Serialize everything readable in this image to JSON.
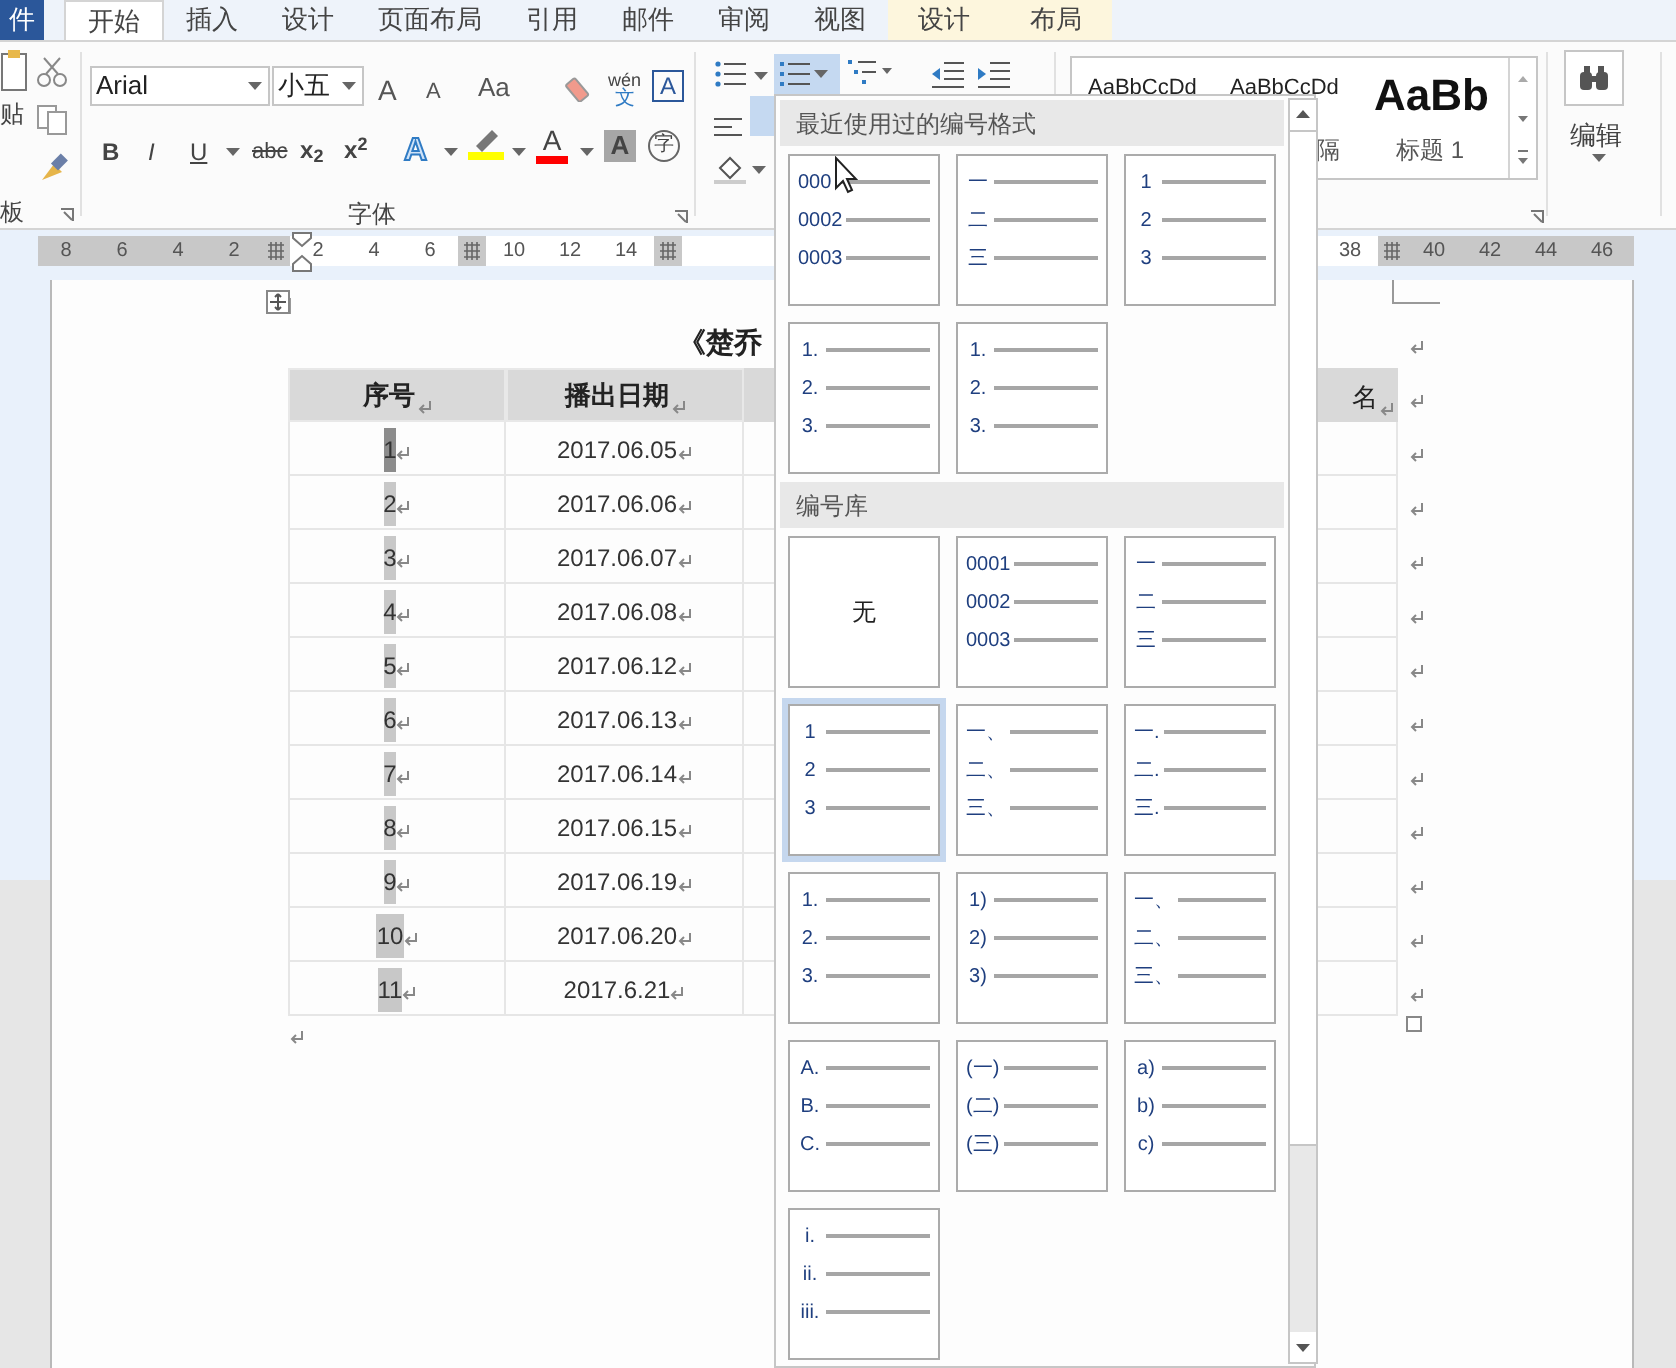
{
  "tabs": [
    {
      "label": "件",
      "kind": "file",
      "selected": false
    },
    {
      "label": "开始",
      "kind": "normal",
      "selected": true
    },
    {
      "label": "插入",
      "kind": "normal",
      "selected": false
    },
    {
      "label": "设计",
      "kind": "normal",
      "selected": false
    },
    {
      "label": "页面布局",
      "kind": "normal",
      "selected": false
    },
    {
      "label": "引用",
      "kind": "normal",
      "selected": false
    },
    {
      "label": "邮件",
      "kind": "normal",
      "selected": false
    },
    {
      "label": "审阅",
      "kind": "normal",
      "selected": false
    },
    {
      "label": "视图",
      "kind": "normal",
      "selected": false
    },
    {
      "label": "设计",
      "kind": "contextual",
      "selected": false
    },
    {
      "label": "布局",
      "kind": "contextual",
      "selected": false
    }
  ],
  "ribbon": {
    "clipboard": {
      "paste_label": "贴",
      "group_label": "板"
    },
    "font": {
      "font_name": "Arial",
      "font_size": "小五",
      "grow": "A",
      "shrink": "A",
      "change_case": "Aa",
      "phonetic_top": "wén",
      "phonetic_bottom": "文",
      "border_char": "A",
      "bold": "B",
      "italic": "I",
      "underline": "U",
      "strikethrough": "abc",
      "subscript": "x$_{2}$",
      "superscript": "x$^{2}$",
      "text_effect": "A",
      "font_color": "A",
      "char_shading": "A",
      "enclose": "字",
      "group_label": "字体"
    },
    "styles": {
      "previews": [
        "AaBbCcDd",
        "AaBbCcDd",
        "AaBb"
      ],
      "labels": [
        "隔",
        "标题 1"
      ]
    },
    "editing": {
      "label": "编辑"
    },
    "numbering_open": true
  },
  "ruler": {
    "left": [
      {
        "kind": "number",
        "text": "8",
        "shaded": true
      },
      {
        "kind": "number",
        "text": "6",
        "shaded": true
      },
      {
        "kind": "number",
        "text": "4",
        "shaded": true
      },
      {
        "kind": "number",
        "text": "2",
        "shaded": true
      },
      {
        "kind": "marker",
        "shaded": true
      },
      {
        "kind": "number",
        "text": "2",
        "shaded": false
      },
      {
        "kind": "number",
        "text": "4",
        "shaded": false
      },
      {
        "kind": "number",
        "text": "6",
        "shaded": false
      },
      {
        "kind": "marker",
        "shaded": true
      },
      {
        "kind": "number",
        "text": "10",
        "shaded": false
      },
      {
        "kind": "number",
        "text": "12",
        "shaded": false
      },
      {
        "kind": "number",
        "text": "14",
        "shaded": false
      },
      {
        "kind": "marker",
        "shaded": true
      }
    ],
    "right": [
      {
        "kind": "number",
        "text": "38",
        "shaded": false
      },
      {
        "kind": "marker",
        "shaded": true
      },
      {
        "kind": "number",
        "text": "40",
        "shaded": true
      },
      {
        "kind": "number",
        "text": "42",
        "shaded": true
      },
      {
        "kind": "number",
        "text": "44",
        "shaded": true
      },
      {
        "kind": "number",
        "text": "46",
        "shaded": true
      }
    ]
  },
  "document": {
    "title": "《楚乔",
    "table": {
      "columns": [
        "序号",
        "播出日期",
        "名"
      ],
      "rows": [
        {
          "number": "1",
          "date": "2017.06.05",
          "selected": true
        },
        {
          "number": "2",
          "date": "2017.06.06",
          "selected": false
        },
        {
          "number": "3",
          "date": "2017.06.07",
          "selected": false
        },
        {
          "number": "4",
          "date": "2017.06.08",
          "selected": false
        },
        {
          "number": "5",
          "date": "2017.06.12",
          "selected": false
        },
        {
          "number": "6",
          "date": "2017.06.13",
          "selected": false
        },
        {
          "number": "7",
          "date": "2017.06.14",
          "selected": false
        },
        {
          "number": "8",
          "date": "2017.06.15",
          "selected": false
        },
        {
          "number": "9",
          "date": "2017.06.19",
          "selected": false
        },
        {
          "number": "10",
          "date": "2017.06.20",
          "selected": false
        },
        {
          "number": "11",
          "date": "2017.6.21",
          "selected": false
        }
      ]
    }
  },
  "numbering_menu": {
    "sections": [
      {
        "title": "最近使用过的编号格式",
        "items": [
          {
            "kind": "list",
            "lines": [
              "000",
              "0002",
              "0003"
            ],
            "selected": false
          },
          {
            "kind": "list",
            "lines": [
              "一",
              "二",
              "三"
            ],
            "selected": false
          },
          {
            "kind": "list",
            "lines": [
              "1",
              "2",
              "3"
            ],
            "selected": false
          },
          {
            "kind": "list",
            "lines": [
              "1.",
              "2.",
              "3."
            ],
            "selected": false
          },
          {
            "kind": "list",
            "lines": [
              "1.",
              "2.",
              "3."
            ],
            "selected": false
          }
        ]
      },
      {
        "title": "编号库",
        "items": [
          {
            "kind": "none",
            "label": "无",
            "selected": false
          },
          {
            "kind": "list",
            "lines": [
              "0001",
              "0002",
              "0003"
            ],
            "selected": false
          },
          {
            "kind": "list",
            "lines": [
              "一",
              "二",
              "三"
            ],
            "selected": false
          },
          {
            "kind": "list",
            "lines": [
              "1",
              "2",
              "3"
            ],
            "selected": true
          },
          {
            "kind": "list",
            "lines": [
              "一、",
              "二、",
              "三、"
            ],
            "selected": false
          },
          {
            "kind": "list",
            "lines": [
              "一.",
              "二.",
              "三."
            ],
            "selected": false
          },
          {
            "kind": "list",
            "lines": [
              "1.",
              "2.",
              "3."
            ],
            "selected": false
          },
          {
            "kind": "list",
            "lines": [
              "1)",
              "2)",
              "3)"
            ],
            "selected": false
          },
          {
            "kind": "list",
            "lines": [
              "一、",
              "二、",
              "三、"
            ],
            "selected": false
          },
          {
            "kind": "list",
            "lines": [
              "A.",
              "B.",
              "C."
            ],
            "selected": false
          },
          {
            "kind": "list",
            "lines": [
              "(一)",
              "(二)",
              "(三)"
            ],
            "selected": false
          },
          {
            "kind": "list",
            "lines": [
              "a)",
              "b)",
              "c)"
            ],
            "selected": false
          },
          {
            "kind": "list",
            "lines": [
              "i.",
              "ii.",
              "iii."
            ],
            "selected": false
          }
        ]
      }
    ]
  }
}
